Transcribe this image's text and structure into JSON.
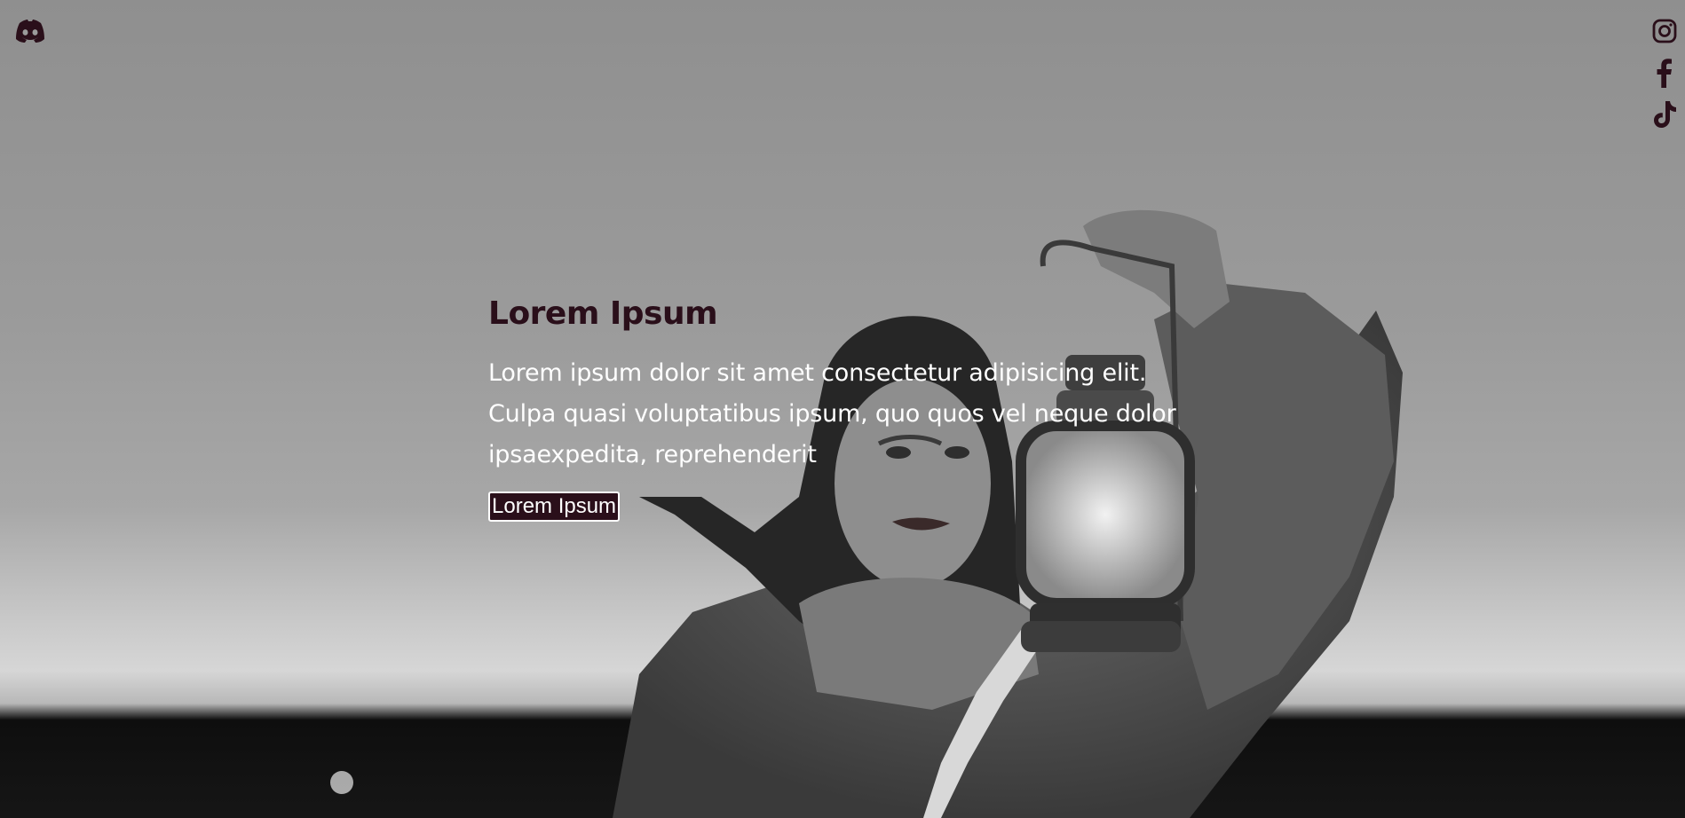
{
  "theme": {
    "accent": "#2a0f1a",
    "text_light": "#ffffff"
  },
  "header": {
    "brand_icon": "discord-icon"
  },
  "social": {
    "items": [
      {
        "icon": "instagram-icon"
      },
      {
        "icon": "facebook-icon"
      },
      {
        "icon": "tiktok-icon"
      }
    ]
  },
  "hero": {
    "title": "Lorem Ipsum",
    "text": "Lorem ipsum dolor sit amet consectetur adipisicing elit. Culpa quasi voluptatibus ipsum, quo quos vel neque dolor ipsaexpedita, reprehenderit",
    "button_label": "Lorem Ipsum",
    "background_image": "black-and-white photo of a woman in a fur coat holding up a lantern"
  }
}
